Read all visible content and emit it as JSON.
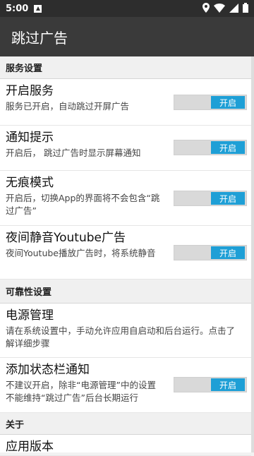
{
  "status_bar": {
    "time": "5:00"
  },
  "app_bar": {
    "title": "跳过广告"
  },
  "sections": [
    {
      "header": "服务设置"
    },
    {
      "header": "可靠性设置"
    },
    {
      "header": "关于"
    }
  ],
  "items": [
    {
      "title": "开启服务",
      "desc": "服务已开启，自动跳过开屏广告",
      "toggle": "开启"
    },
    {
      "title": "通知提示",
      "desc": "开启后， 跳过广告时显示屏幕通知",
      "toggle": "开启"
    },
    {
      "title": "无痕模式",
      "desc": "开启后，切换App的界面将不会包含“跳过广告”",
      "toggle": "开启"
    },
    {
      "title": "夜间静音Youtube广告",
      "desc": "夜间Youtube播放广告时，将系统静音",
      "toggle": "开启"
    },
    {
      "title": "电源管理",
      "desc": "请在系统设置中，手动允许应用自启动和后台运行。点击了解详细步骤"
    },
    {
      "title": "添加状态栏通知",
      "desc": "不建议开启，除非“电源管理”中的设置不能维持“跳过广告”后台长期运行",
      "toggle": "开启"
    },
    {
      "title": "应用版本"
    }
  ]
}
